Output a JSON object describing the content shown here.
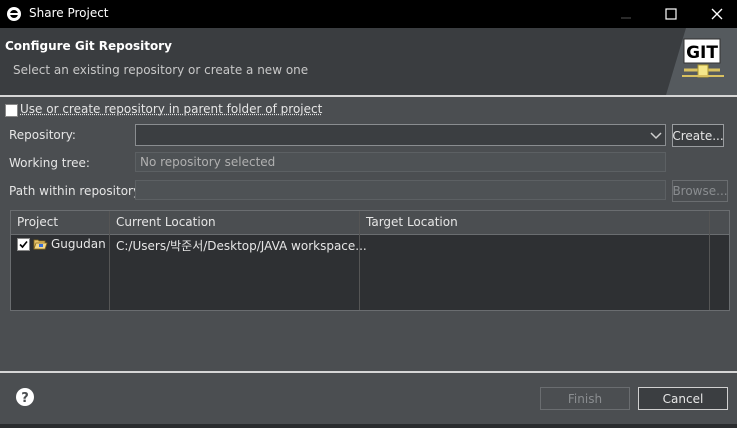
{
  "window": {
    "title": "Share Project",
    "minimize_glyph": "—",
    "maximize_glyph": "☐",
    "close_glyph": "✕"
  },
  "banner": {
    "title": "Configure Git Repository",
    "subtitle": "Select an existing repository or create a new one",
    "logo_text": "GIT"
  },
  "options": {
    "use_parent_label": "Use or create repository in parent folder of project",
    "use_parent_checked": false
  },
  "form": {
    "repository_label": "Repository:",
    "repository_value": "",
    "create_button": "Create...",
    "working_tree_label": "Working tree:",
    "working_tree_value": "No repository selected",
    "path_label": "Path within repository:",
    "path_value": "",
    "browse_button": "Browse..."
  },
  "table": {
    "columns": [
      "Project",
      "Current Location",
      "Target Location"
    ],
    "rows": [
      {
        "checked": true,
        "project": "Gugudan",
        "current_location": "C:/Users/박준서/Desktop/JAVA workspace...",
        "target_location": ""
      }
    ]
  },
  "footer": {
    "finish_button": "Finish",
    "cancel_button": "Cancel"
  },
  "colors": {
    "background": "#4b4e51",
    "banner": "#3a3d40",
    "titlebar": "#000000",
    "table": "#2e3033"
  }
}
